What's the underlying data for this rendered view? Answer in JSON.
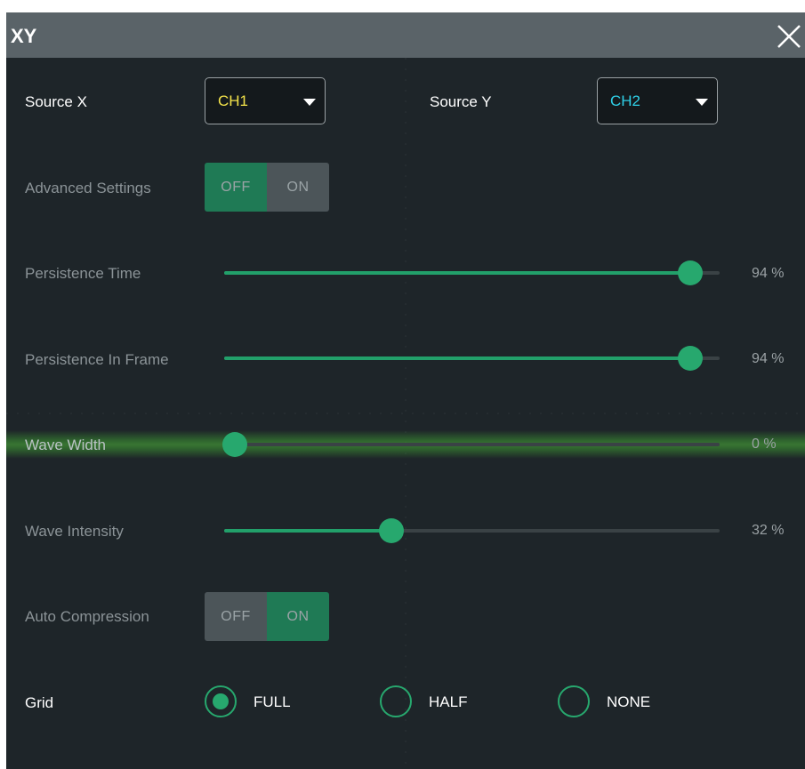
{
  "dialog": {
    "title": "XY",
    "close_icon": "close-icon"
  },
  "source_x": {
    "label": "Source X",
    "value": "CH1",
    "color": "#f4e34a"
  },
  "source_y": {
    "label": "Source Y",
    "value": "CH2",
    "color": "#2fd0e8"
  },
  "advanced_settings": {
    "label": "Advanced Settings",
    "off": "OFF",
    "on": "ON",
    "selected": "OFF"
  },
  "persistence_time": {
    "label": "Persistence Time",
    "percent": 94,
    "display": "94 %"
  },
  "persistence_in_frame": {
    "label": "Persistence In Frame",
    "percent": 94,
    "display": "94 %"
  },
  "wave_width": {
    "label": "Wave Width",
    "percent": 0,
    "display": "0 %"
  },
  "wave_intensity": {
    "label": "Wave Intensity",
    "percent": 32,
    "display": "32 %"
  },
  "auto_compression": {
    "label": "Auto Compression",
    "off": "OFF",
    "on": "ON",
    "selected": "ON"
  },
  "grid": {
    "label": "Grid",
    "options": [
      "FULL",
      "HALF",
      "NONE"
    ],
    "selected": "FULL"
  },
  "colors": {
    "accent": "#27a86e",
    "toggle_active": "#1f7a55",
    "background": "#1e2529",
    "titlebar": "#5a6368"
  }
}
